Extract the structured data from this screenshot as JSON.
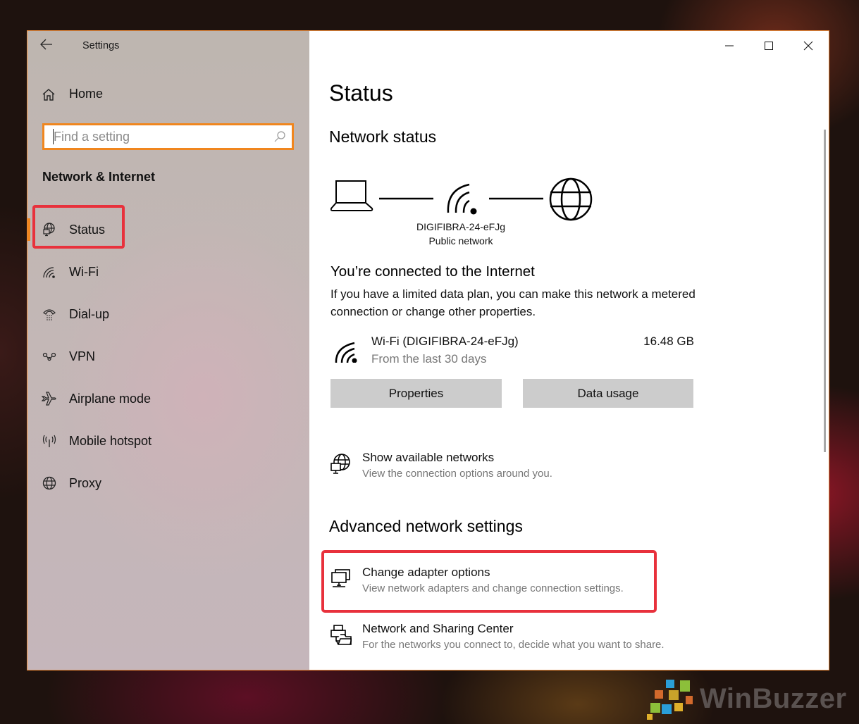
{
  "window": {
    "title": "Settings",
    "controls": {
      "minimize": "minimize",
      "maximize": "maximize",
      "close": "close"
    },
    "accent_color": "#f0861e",
    "annotation_color": "#e8313c"
  },
  "sidebar": {
    "home_label": "Home",
    "search": {
      "placeholder": "Find a setting",
      "value": ""
    },
    "section_heading": "Network & Internet",
    "items": [
      {
        "label": "Status",
        "icon": "status-globe-monitor-icon",
        "active": true
      },
      {
        "label": "Wi-Fi",
        "icon": "wifi-icon",
        "active": false
      },
      {
        "label": "Dial-up",
        "icon": "dialup-phone-icon",
        "active": false
      },
      {
        "label": "VPN",
        "icon": "vpn-icon",
        "active": false
      },
      {
        "label": "Airplane mode",
        "icon": "airplane-icon",
        "active": false
      },
      {
        "label": "Mobile hotspot",
        "icon": "hotspot-icon",
        "active": false
      },
      {
        "label": "Proxy",
        "icon": "globe-icon",
        "active": false
      }
    ]
  },
  "main": {
    "page_title": "Status",
    "network_status_heading": "Network status",
    "network": {
      "ssid": "DIGIFIBRA-24-eFJg",
      "type": "Public network"
    },
    "connected_title": "You’re connected to the Internet",
    "connected_desc": "If you have a limited data plan, you can make this network a metered connection or change other properties.",
    "connection": {
      "name": "Wi-Fi (DIGIFIBRA-24-eFJg)",
      "subtitle": "From the last 30 days",
      "usage": "16.48 GB"
    },
    "buttons": {
      "properties": "Properties",
      "data_usage": "Data usage"
    },
    "show_networks": {
      "title": "Show available networks",
      "subtitle": "View the connection options around you."
    },
    "advanced_heading": "Advanced network settings",
    "advanced_items": [
      {
        "title": "Change adapter options",
        "subtitle": "View network adapters and change connection settings."
      },
      {
        "title": "Network and Sharing Center",
        "subtitle": "For the networks you connect to, decide what you want to share."
      }
    ]
  },
  "watermark": {
    "text": "WinBuzzer"
  }
}
